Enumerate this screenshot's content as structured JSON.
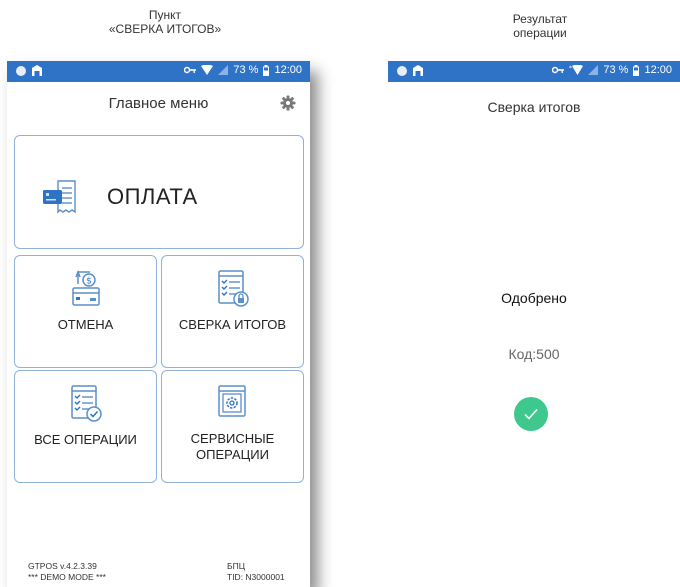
{
  "captions": {
    "left_line1": "Пункт",
    "left_line2": "«СВЕРКА ИТОГОВ»",
    "right_line1": "Результат",
    "right_line2": "операции"
  },
  "status_bar": {
    "battery": "73 %",
    "time": "12:00",
    "background": "#2f73c6"
  },
  "main_menu": {
    "title": "Главное меню",
    "tiles": {
      "payment": "ОПЛАТА",
      "cancel": "ОТМЕНА",
      "reconciliation": "СВЕРКА ИТОГОВ",
      "all_ops": "ВСЕ ОПЕРАЦИИ",
      "service_line1": "СЕРВИСНЫЕ",
      "service_line2": "ОПЕРАЦИИ"
    },
    "footer": {
      "version": "GTPOS v.4.2.3.39",
      "mode": "*** DEMO MODE ***",
      "bank": "БПЦ",
      "tid": "TID: N3000001"
    }
  },
  "result": {
    "title": "Сверка итогов",
    "status": "Одобрено",
    "code": "Код:500",
    "success_color": "#3fc88e"
  },
  "icons": {
    "gear": "gear-icon",
    "payment": "card-receipt-icon",
    "cancel": "refund-icon",
    "reconciliation": "checklist-lock-icon",
    "all_ops": "checklist-check-icon",
    "service": "window-gear-icon",
    "success": "check-circle-icon"
  }
}
